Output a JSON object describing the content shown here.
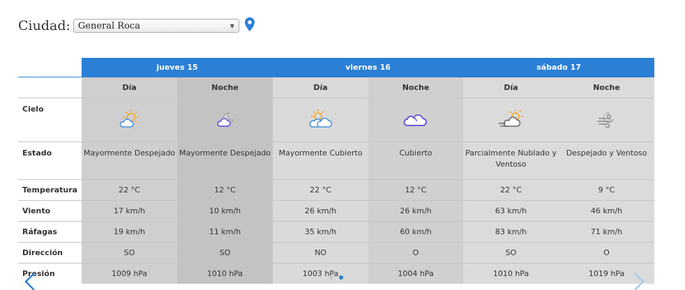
{
  "city": {
    "label": "Ciudad:",
    "selected": "General Roca"
  },
  "days": [
    {
      "label": "jueves 15"
    },
    {
      "label": "viernes 16"
    },
    {
      "label": "sábado 17"
    }
  ],
  "periods": [
    "Día",
    "Noche",
    "Día",
    "Noche",
    "Día",
    "Noche"
  ],
  "row_labels": {
    "cielo": "Cielo",
    "estado": "Estado",
    "temperatura": "Temperatura",
    "viento": "Viento",
    "rafagas": "Ráfagas",
    "direccion": "Dirección",
    "presion": "Presión"
  },
  "icons": [
    "partly-cloudy-day-icon",
    "partly-cloudy-night-icon",
    "mostly-cloudy-day-icon",
    "cloudy-icon",
    "partly-cloudy-windy-icon",
    "windy-clear-night-icon"
  ],
  "estado": [
    "Mayormente Despejado",
    "Mayormente Despejado",
    "Mayormente Cubierto",
    "Cubierto",
    "Parcialmente Nublado y Ventoso",
    "Despejado y Ventoso"
  ],
  "temperatura": [
    "22 °C",
    "12 °C",
    "22 °C",
    "12 °C",
    "22 °C",
    "9 °C"
  ],
  "viento": [
    "17 km/h",
    "10 km/h",
    "26 km/h",
    "26 km/h",
    "63 km/h",
    "46 km/h"
  ],
  "rafagas": [
    "19 km/h",
    "11 km/h",
    "35 km/h",
    "60 km/h",
    "83 km/h",
    "71 km/h"
  ],
  "direccion": [
    "SO",
    "SO",
    "NO",
    "O",
    "SO",
    "O"
  ],
  "presion": [
    "1009 hPa",
    "1010 hPa",
    "1003 hPa",
    "1004 hPa",
    "1010 hPa",
    "1019 hPa"
  ],
  "colors": {
    "accent": "#2b7fd4",
    "sun": "#f5a623",
    "cloud": "#6b5bd6"
  }
}
